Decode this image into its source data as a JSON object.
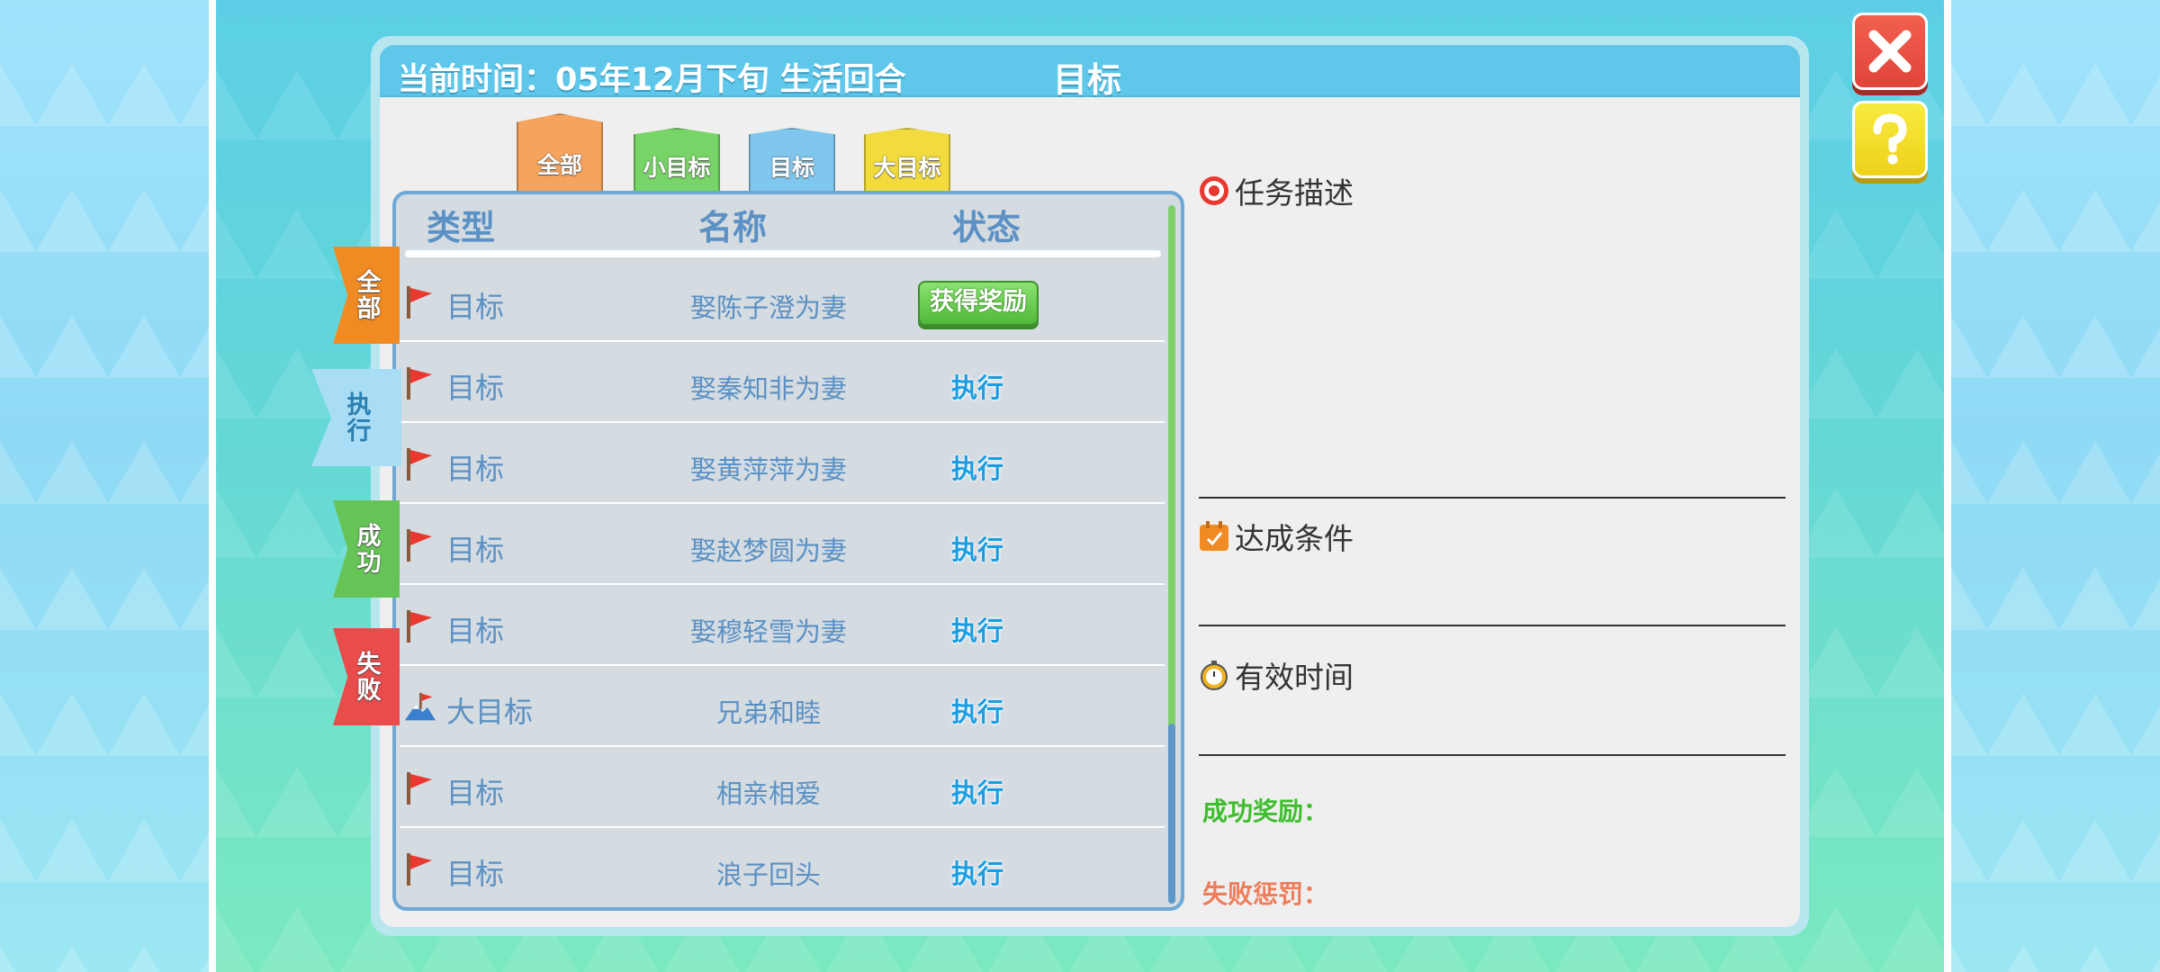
{
  "header": {
    "time_text": "当前时间：05年12月下旬  生活回合",
    "title": "目标"
  },
  "top_tabs": [
    {
      "label": "全部"
    },
    {
      "label": "小目标"
    },
    {
      "label": "目标"
    },
    {
      "label": "大目标"
    }
  ],
  "side_tabs": [
    {
      "label": "全部"
    },
    {
      "label": "执行"
    },
    {
      "label": "成功"
    },
    {
      "label": "失败"
    }
  ],
  "list": {
    "columns": [
      "类型",
      "名称",
      "状态"
    ],
    "rows": [
      {
        "type": "目标",
        "name": "娶陈子澄为妻",
        "status": "获得奖励",
        "icon": "red-flag-icon"
      },
      {
        "type": "目标",
        "name": "娶秦知非为妻",
        "status": "执行",
        "icon": "red-flag-icon"
      },
      {
        "type": "目标",
        "name": "娶黄萍萍为妻",
        "status": "执行",
        "icon": "red-flag-icon"
      },
      {
        "type": "目标",
        "name": "娶赵梦圆为妻",
        "status": "执行",
        "icon": "red-flag-icon"
      },
      {
        "type": "目标",
        "name": "娶穆轻雪为妻",
        "status": "执行",
        "icon": "red-flag-icon"
      },
      {
        "type": "大目标",
        "name": "兄弟和睦",
        "status": "执行",
        "icon": "mountain-flag-icon"
      },
      {
        "type": "目标",
        "name": "相亲相爱",
        "status": "执行",
        "icon": "red-flag-icon"
      },
      {
        "type": "目标",
        "name": "浪子回头",
        "status": "执行",
        "icon": "red-flag-icon"
      }
    ]
  },
  "info": {
    "task_desc_label": "任务描述",
    "condition_label": "达成条件",
    "valid_time_label": "有效时间",
    "success_reward_label": "成功奖励：",
    "fail_penalty_label": "失败惩罚："
  },
  "colors": {
    "header_bg": "#5ec7ea",
    "success_text": "#3fbd2f",
    "fail_text": "#f07c5a",
    "status_text": "#1b9de2"
  }
}
